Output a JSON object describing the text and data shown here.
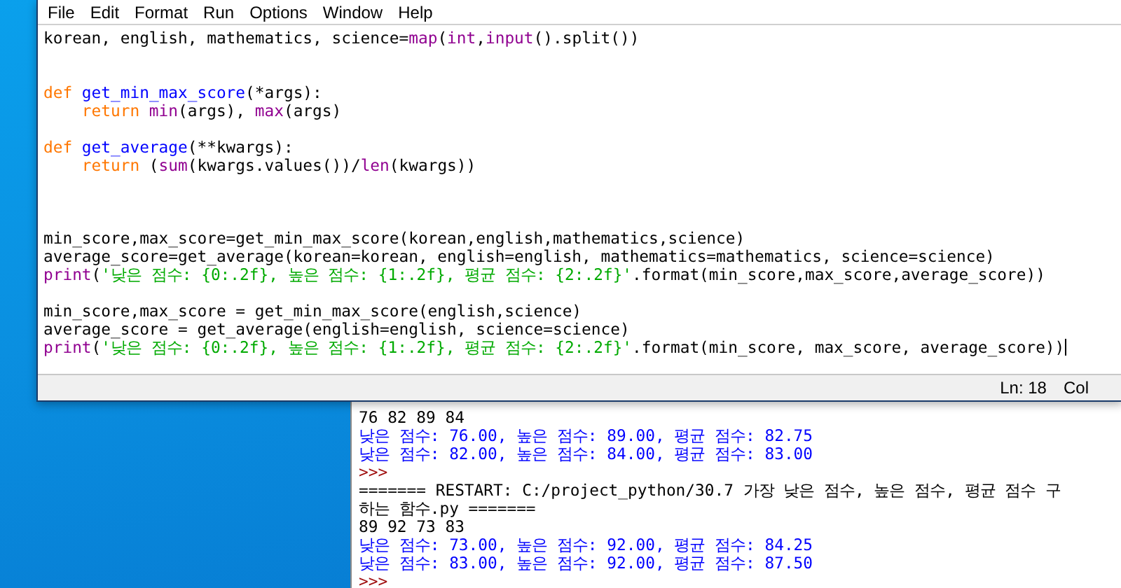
{
  "editor": {
    "menu": [
      "File",
      "Edit",
      "Format",
      "Run",
      "Options",
      "Window",
      "Help"
    ],
    "lines": [
      {
        "kind": "code",
        "segments": [
          {
            "kind": "plain",
            "t": "korean, english, mathematics, science="
          },
          {
            "kind": "builtin",
            "t": "map"
          },
          {
            "kind": "plain",
            "t": "("
          },
          {
            "kind": "builtin",
            "t": "int"
          },
          {
            "kind": "plain",
            "t": ","
          },
          {
            "kind": "builtin",
            "t": "input"
          },
          {
            "kind": "plain",
            "t": "().split())"
          }
        ]
      },
      {
        "kind": "blank"
      },
      {
        "kind": "blank"
      },
      {
        "kind": "code",
        "segments": [
          {
            "kind": "keyword",
            "t": "def"
          },
          {
            "kind": "defname",
            "t": " get_min_max_score"
          },
          {
            "kind": "plain",
            "t": "(*args):"
          }
        ]
      },
      {
        "kind": "code",
        "segments": [
          {
            "kind": "keyword",
            "t": "    return"
          },
          {
            "kind": "builtin",
            "t": " min"
          },
          {
            "kind": "plain",
            "t": "(args), "
          },
          {
            "kind": "builtin",
            "t": "max"
          },
          {
            "kind": "plain",
            "t": "(args)"
          }
        ]
      },
      {
        "kind": "blank"
      },
      {
        "kind": "code",
        "segments": [
          {
            "kind": "keyword",
            "t": "def"
          },
          {
            "kind": "defname",
            "t": " get_average"
          },
          {
            "kind": "plain",
            "t": "(**kwargs):"
          }
        ]
      },
      {
        "kind": "code",
        "segments": [
          {
            "kind": "keyword",
            "t": "    return"
          },
          {
            "kind": "plain",
            "t": " ("
          },
          {
            "kind": "builtin",
            "t": "sum"
          },
          {
            "kind": "plain",
            "t": "(kwargs.values())/"
          },
          {
            "kind": "builtin",
            "t": "len"
          },
          {
            "kind": "plain",
            "t": "(kwargs))"
          }
        ]
      },
      {
        "kind": "blank"
      },
      {
        "kind": "blank"
      },
      {
        "kind": "blank"
      },
      {
        "kind": "code",
        "segments": [
          {
            "kind": "plain",
            "t": "min_score,max_score=get_min_max_score(korean,english,mathematics,science)"
          }
        ]
      },
      {
        "kind": "code",
        "segments": [
          {
            "kind": "plain",
            "t": "average_score=get_average(korean=korean, english=english, mathematics=mathematics, science=science)"
          }
        ]
      },
      {
        "kind": "code",
        "segments": [
          {
            "kind": "builtin",
            "t": "print"
          },
          {
            "kind": "plain",
            "t": "("
          },
          {
            "kind": "string",
            "t": "'낮은 점수: {0:.2f}, 높은 점수: {1:.2f}, 평균 점수: {2:.2f}'"
          },
          {
            "kind": "plain",
            "t": ".format(min_score,max_score,average_score))"
          }
        ]
      },
      {
        "kind": "blank"
      },
      {
        "kind": "code",
        "segments": [
          {
            "kind": "plain",
            "t": "min_score,max_score = get_min_max_score(english,science)"
          }
        ]
      },
      {
        "kind": "code",
        "segments": [
          {
            "kind": "plain",
            "t": "average_score = get_average(english=english, science=science)"
          }
        ]
      },
      {
        "kind": "code",
        "segments": [
          {
            "kind": "builtin",
            "t": "print"
          },
          {
            "kind": "plain",
            "t": "("
          },
          {
            "kind": "string",
            "t": "'낮은 점수: {0:.2f}, 높은 점수: {1:.2f}, 평균 점수: {2:.2f}'"
          },
          {
            "kind": "plain",
            "t": ".format(min_score, max_score, average_score))"
          }
        ]
      }
    ],
    "status": {
      "line": "Ln: 18",
      "column": "Col"
    }
  },
  "shell": {
    "lines": [
      {
        "kind": "input",
        "text": "76 82 89 84"
      },
      {
        "kind": "output",
        "text": "낮은 점수: 76.00, 높은 점수: 89.00, 평균 점수: 82.75"
      },
      {
        "kind": "output",
        "text": "낮은 점수: 82.00, 높은 점수: 84.00, 평균 점수: 83.00"
      },
      {
        "kind": "prompt",
        "text": ">>>"
      },
      {
        "kind": "input",
        "text": "======= RESTART: C:/project_python/30.7 가장 낮은 점수, 높은 점수, 평균 점수 구"
      },
      {
        "kind": "input",
        "text": "하는 함수.py ======="
      },
      {
        "kind": "input",
        "text": "89 92 73 83"
      },
      {
        "kind": "output",
        "text": "낮은 점수: 73.00, 높은 점수: 92.00, 평균 점수: 84.25"
      },
      {
        "kind": "output",
        "text": "낮은 점수: 83.00, 높은 점수: 92.00, 평균 점수: 87.50"
      },
      {
        "kind": "prompt",
        "text": ">>>"
      }
    ]
  }
}
